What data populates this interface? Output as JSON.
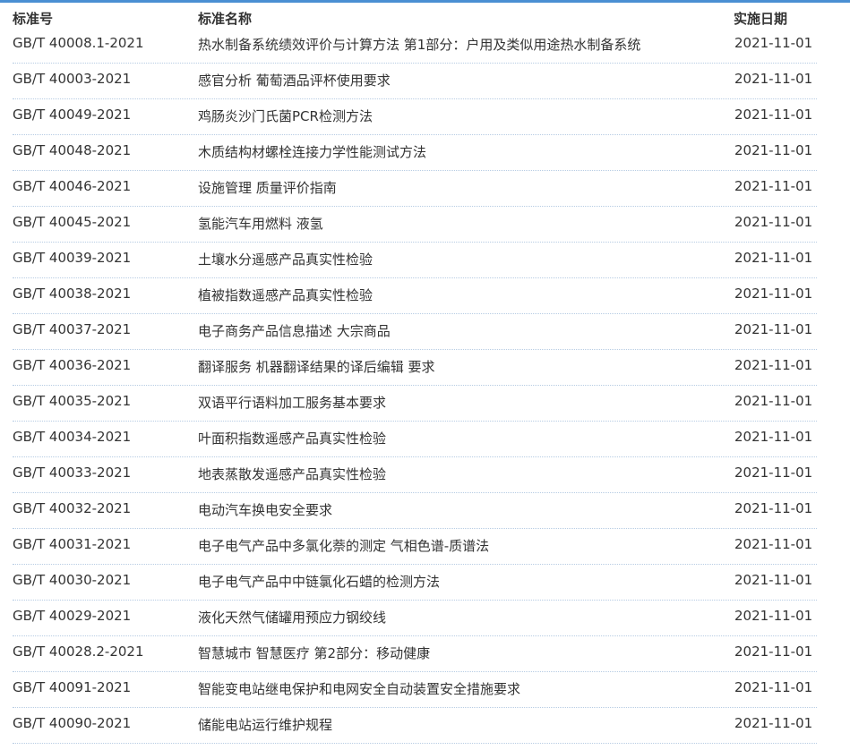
{
  "table": {
    "headers": {
      "code": "标准号",
      "name": "标准名称",
      "date": "实施日期"
    },
    "rows": [
      {
        "code": "GB/T 40008.1-2021",
        "name": "热水制备系统绩效评价与计算方法 第1部分：户用及类似用途热水制备系统",
        "date": "2021-11-01"
      },
      {
        "code": "GB/T 40003-2021",
        "name": "感官分析 葡萄酒品评杯使用要求",
        "date": "2021-11-01"
      },
      {
        "code": "GB/T 40049-2021",
        "name": "鸡肠炎沙门氏菌PCR检测方法",
        "date": "2021-11-01"
      },
      {
        "code": "GB/T 40048-2021",
        "name": "木质结构材螺栓连接力学性能测试方法",
        "date": "2021-11-01"
      },
      {
        "code": "GB/T 40046-2021",
        "name": "设施管理 质量评价指南",
        "date": "2021-11-01"
      },
      {
        "code": "GB/T 40045-2021",
        "name": "氢能汽车用燃料 液氢",
        "date": "2021-11-01"
      },
      {
        "code": "GB/T 40039-2021",
        "name": "土壤水分遥感产品真实性检验",
        "date": "2021-11-01"
      },
      {
        "code": "GB/T 40038-2021",
        "name": "植被指数遥感产品真实性检验",
        "date": "2021-11-01"
      },
      {
        "code": "GB/T 40037-2021",
        "name": "电子商务产品信息描述 大宗商品",
        "date": "2021-11-01"
      },
      {
        "code": "GB/T 40036-2021",
        "name": "翻译服务 机器翻译结果的译后编辑 要求",
        "date": "2021-11-01"
      },
      {
        "code": "GB/T 40035-2021",
        "name": "双语平行语料加工服务基本要求",
        "date": "2021-11-01"
      },
      {
        "code": "GB/T 40034-2021",
        "name": "叶面积指数遥感产品真实性检验",
        "date": "2021-11-01"
      },
      {
        "code": "GB/T 40033-2021",
        "name": "地表蒸散发遥感产品真实性检验",
        "date": "2021-11-01"
      },
      {
        "code": "GB/T 40032-2021",
        "name": "电动汽车换电安全要求",
        "date": "2021-11-01"
      },
      {
        "code": "GB/T 40031-2021",
        "name": "电子电气产品中多氯化萘的测定 气相色谱-质谱法",
        "date": "2021-11-01"
      },
      {
        "code": "GB/T 40030-2021",
        "name": "电子电气产品中中链氯化石蜡的检测方法",
        "date": "2021-11-01"
      },
      {
        "code": "GB/T 40029-2021",
        "name": "液化天然气储罐用预应力钢绞线",
        "date": "2021-11-01"
      },
      {
        "code": "GB/T 40028.2-2021",
        "name": "智慧城市 智慧医疗 第2部分：移动健康",
        "date": "2021-11-01"
      },
      {
        "code": "GB/T 40091-2021",
        "name": "智能变电站继电保护和电网安全自动装置安全措施要求",
        "date": "2021-11-01"
      },
      {
        "code": "GB/T 40090-2021",
        "name": "储能电站运行维护规程",
        "date": "2021-11-01"
      }
    ]
  },
  "colors": {
    "accent_bar": "#4a8fd3",
    "row_divider": "#b7cce3",
    "text": "#333333"
  }
}
